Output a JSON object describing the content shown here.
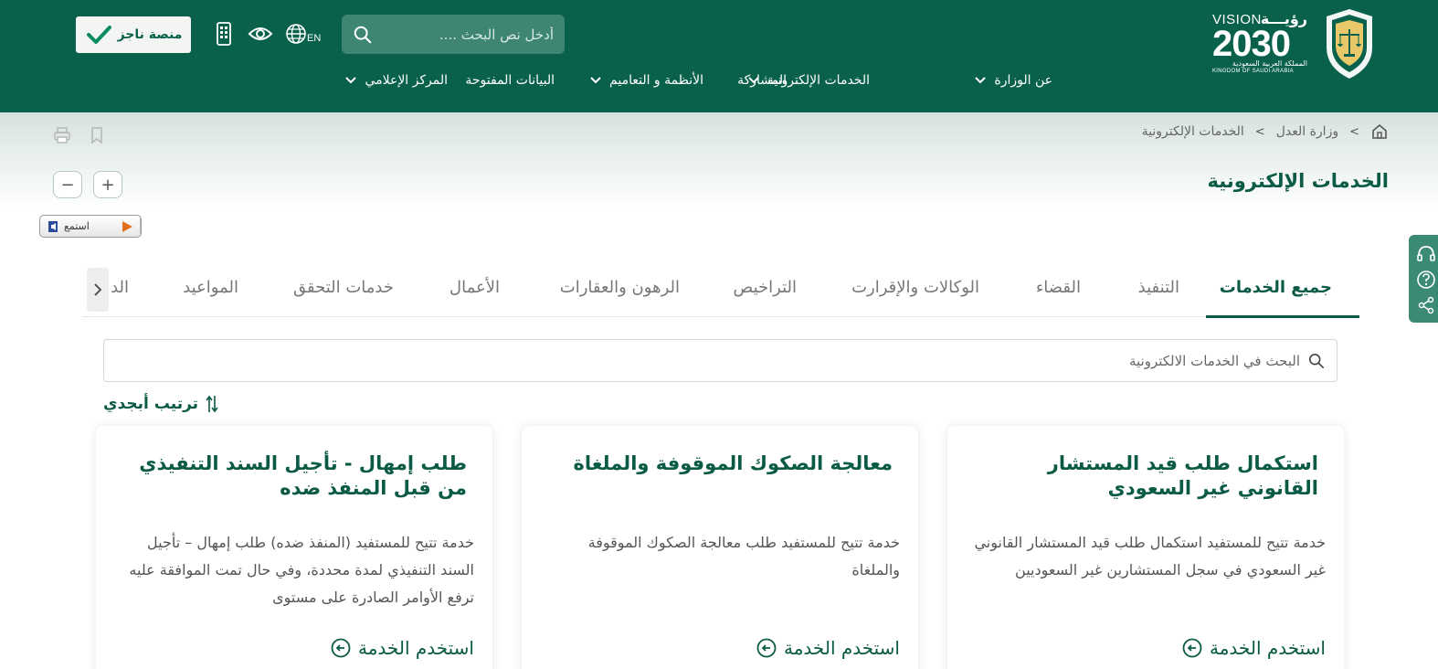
{
  "header": {
    "vision": {
      "en_top": "VISION",
      "ar_top": "رؤيـــة",
      "year": "2030",
      "ar_country": "المملكة العربية السعودية",
      "en_country": "KINGDOM OF SAUDI ARABIA"
    },
    "search_placeholder": "أدخل نص البحث ....",
    "lang_label": "EN",
    "najez_label": "منصة ناجز",
    "nav": [
      {
        "label": "عن الوزارة",
        "has_dropdown": true
      },
      {
        "label": "الخدمات الإلكترونية",
        "has_dropdown": true
      },
      {
        "label": "المشاركة",
        "has_dropdown": false
      },
      {
        "label": "الأنظمة و التعاميم",
        "has_dropdown": true
      },
      {
        "label": "البيانات المفتوحة",
        "has_dropdown": false
      },
      {
        "label": "المركز الإعلامي",
        "has_dropdown": true
      }
    ]
  },
  "breadcrumb": {
    "items": [
      "وزارة العدل",
      "الخدمات الإلكترونية"
    ],
    "separator": ">"
  },
  "page": {
    "title": "الخدمات الإلكترونية",
    "zoom_in": "+",
    "zoom_out": "−",
    "listen_label": "استمع"
  },
  "tabs": [
    {
      "label": "جميع الخدمات",
      "active": true
    },
    {
      "label": "التنفيذ",
      "active": false
    },
    {
      "label": "القضاء",
      "active": false
    },
    {
      "label": "الوكالات والإقرارت",
      "active": false
    },
    {
      "label": "التراخيص",
      "active": false
    },
    {
      "label": "الرهون والعقارات",
      "active": false
    },
    {
      "label": "الأعمال",
      "active": false
    },
    {
      "label": "خدمات التحقق",
      "active": false
    },
    {
      "label": "المواعيد",
      "active": false
    },
    {
      "label": "الد",
      "active": false
    }
  ],
  "service_search": {
    "placeholder": "البحث في الخدمات الالكترونية"
  },
  "sort_label": "ترتيب أبجدي",
  "cards": [
    {
      "title": "استكمال طلب قيد المستشار القانوني غير السعودي",
      "description": "خدمة تتيح للمستفيد استكمال طلب قيد المستشار القانوني غير السعودي في سجل المستشارين غير السعوديين",
      "cta": "استخدم الخدمة"
    },
    {
      "title": "معالجة الصكوك الموقوفة والملغاة",
      "description": "خدمة تتيح للمستفيد طلب معالجة الصكوك الموقوفة والملغاة",
      "cta": "استخدم الخدمة"
    },
    {
      "title": "طلب إمهال - تأجيل السند التنفيذي من قبل المنفذ ضده",
      "description": "خدمة تتيح للمستفيد (المنفذ ضده) طلب إمهال – تأجيل السند التنفيذي لمدة محددة، وفي حال تمت الموافقة عليه ترفع الأوامر الصادرة على مستوى",
      "cta": "استخدم الخدمة"
    }
  ],
  "colors": {
    "header_bg": "#09614c",
    "brand_green": "#0a5a46",
    "search_bg": "#3e8673"
  }
}
